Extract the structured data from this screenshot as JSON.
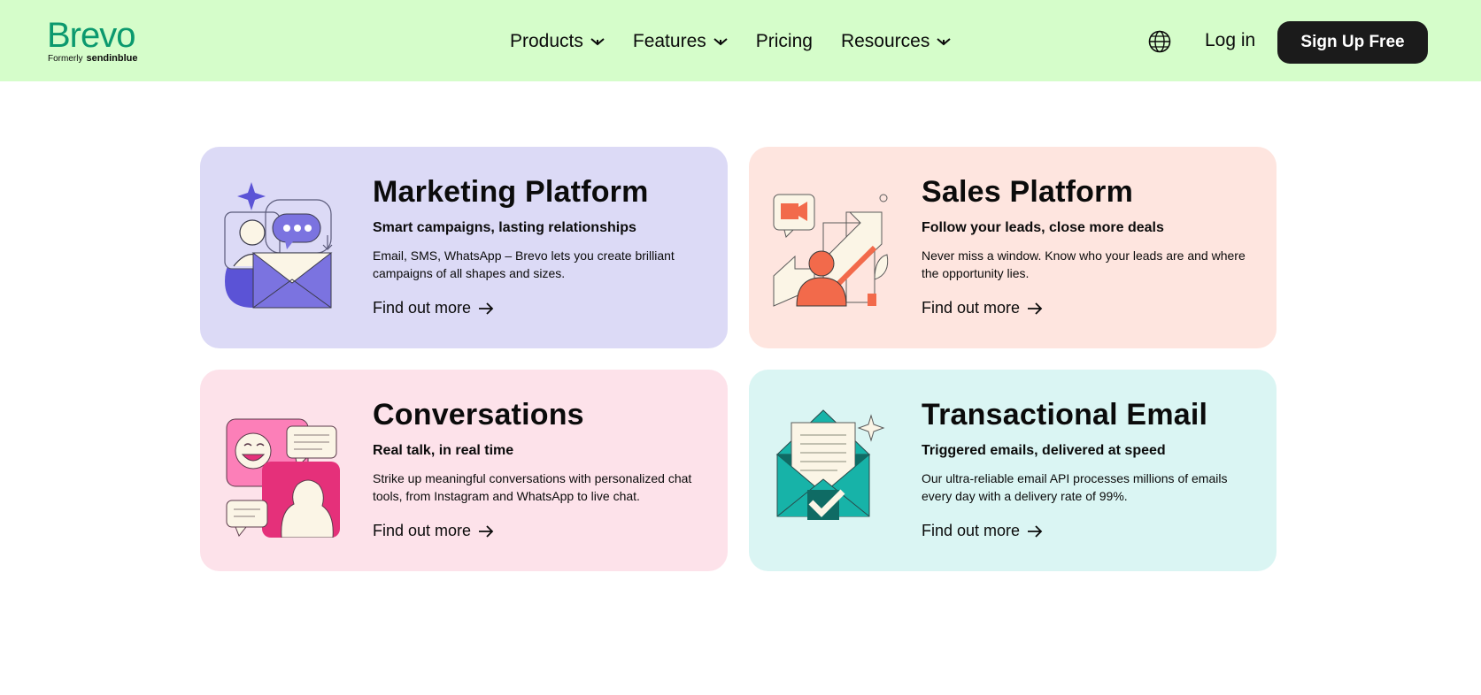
{
  "header": {
    "logo": {
      "wordmark": "Brevo",
      "formerly_label": "Formerly",
      "former_brand": "sendinblue"
    },
    "nav": [
      {
        "label": "Products",
        "has_dropdown": true
      },
      {
        "label": "Features",
        "has_dropdown": true
      },
      {
        "label": "Pricing",
        "has_dropdown": false
      },
      {
        "label": "Resources",
        "has_dropdown": true
      }
    ],
    "language_icon": "globe-icon",
    "login_label": "Log in",
    "signup_label": "Sign Up Free"
  },
  "cards": [
    {
      "title": "Marketing Platform",
      "subtitle": "Smart campaigns, lasting relationships",
      "description": "Email, SMS, WhatsApp – Brevo lets you create brilliant campaigns of all shapes and sizes.",
      "link_label": "Find out more",
      "background": "#dcdaf6"
    },
    {
      "title": "Sales Platform",
      "subtitle": "Follow your leads, close more deals",
      "description": "Never miss a window. Know who your leads are and where the opportunity lies.",
      "link_label": "Find out more",
      "background": "#fee5df"
    },
    {
      "title": "Conversations",
      "subtitle": "Real talk, in real time",
      "description": "Strike up meaningful conversations with personalized chat tools, from Instagram and WhatsApp to live chat.",
      "link_label": "Find out more",
      "background": "#fde2ea"
    },
    {
      "title": "Transactional Email",
      "subtitle": "Triggered emails, delivered at speed",
      "description": "Our ultra-reliable email API processes millions of emails every day with a delivery rate of 99%.",
      "link_label": "Find out more",
      "background": "#daf5f3"
    }
  ],
  "colors": {
    "header_bg": "#d5fdca",
    "brand_green": "#0b996e",
    "button_dark": "#1b1b1b"
  }
}
